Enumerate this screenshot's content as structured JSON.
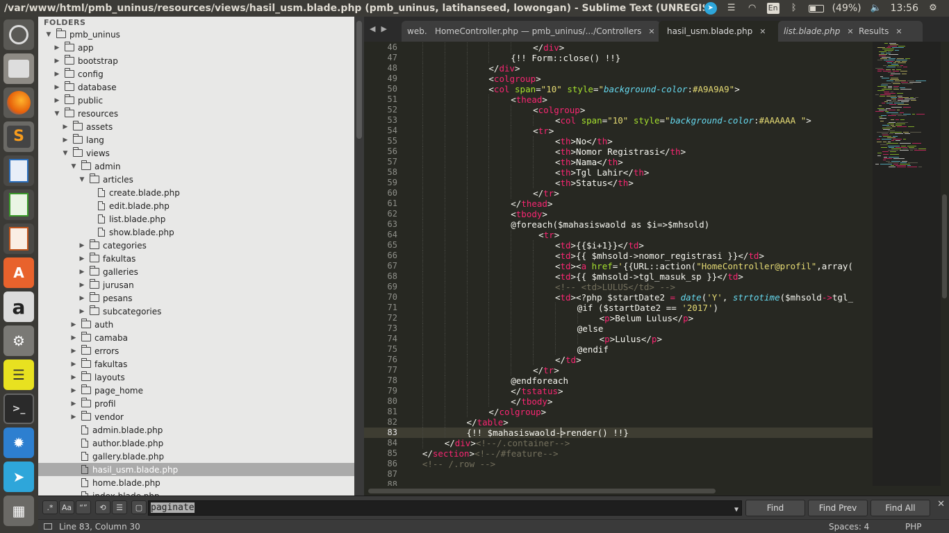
{
  "window": {
    "title": "/var/www/html/pmb_uninus/resources/views/hasil_usm.blade.php (pmb_uninus, latihanseed, lowongan) - Sublime Text (UNREGISTERED)"
  },
  "indicators": {
    "keyboard": "En",
    "battery": "(49%)",
    "clock": "13:56"
  },
  "sidebar": {
    "header": "FOLDERS",
    "items": [
      {
        "label": "pmb_uninus",
        "type": "folder",
        "open": true,
        "depth": 0
      },
      {
        "label": "app",
        "type": "folder",
        "open": false,
        "depth": 1
      },
      {
        "label": "bootstrap",
        "type": "folder",
        "open": false,
        "depth": 1
      },
      {
        "label": "config",
        "type": "folder",
        "open": false,
        "depth": 1
      },
      {
        "label": "database",
        "type": "folder",
        "open": false,
        "depth": 1
      },
      {
        "label": "public",
        "type": "folder",
        "open": false,
        "depth": 1
      },
      {
        "label": "resources",
        "type": "folder",
        "open": true,
        "depth": 1
      },
      {
        "label": "assets",
        "type": "folder",
        "open": false,
        "depth": 2
      },
      {
        "label": "lang",
        "type": "folder",
        "open": false,
        "depth": 2
      },
      {
        "label": "views",
        "type": "folder",
        "open": true,
        "depth": 2
      },
      {
        "label": "admin",
        "type": "folder",
        "open": true,
        "depth": 3
      },
      {
        "label": "articles",
        "type": "folder",
        "open": true,
        "depth": 4
      },
      {
        "label": "create.blade.php",
        "type": "file",
        "depth": 5
      },
      {
        "label": "edit.blade.php",
        "type": "file",
        "depth": 5
      },
      {
        "label": "list.blade.php",
        "type": "file",
        "depth": 5
      },
      {
        "label": "show.blade.php",
        "type": "file",
        "depth": 5
      },
      {
        "label": "categories",
        "type": "folder",
        "open": false,
        "depth": 4
      },
      {
        "label": "fakultas",
        "type": "folder",
        "open": false,
        "depth": 4
      },
      {
        "label": "galleries",
        "type": "folder",
        "open": false,
        "depth": 4
      },
      {
        "label": "jurusan",
        "type": "folder",
        "open": false,
        "depth": 4
      },
      {
        "label": "pesans",
        "type": "folder",
        "open": false,
        "depth": 4
      },
      {
        "label": "subcategories",
        "type": "folder",
        "open": false,
        "depth": 4
      },
      {
        "label": "auth",
        "type": "folder",
        "open": false,
        "depth": 3
      },
      {
        "label": "camaba",
        "type": "folder",
        "open": false,
        "depth": 3
      },
      {
        "label": "errors",
        "type": "folder",
        "open": false,
        "depth": 3
      },
      {
        "label": "fakultas",
        "type": "folder",
        "open": false,
        "depth": 3
      },
      {
        "label": "layouts",
        "type": "folder",
        "open": false,
        "depth": 3
      },
      {
        "label": "page_home",
        "type": "folder",
        "open": false,
        "depth": 3
      },
      {
        "label": "profil",
        "type": "folder",
        "open": false,
        "depth": 3
      },
      {
        "label": "vendor",
        "type": "folder",
        "open": false,
        "depth": 3
      },
      {
        "label": "admin.blade.php",
        "type": "file",
        "depth": 3
      },
      {
        "label": "author.blade.php",
        "type": "file",
        "depth": 3
      },
      {
        "label": "gallery.blade.php",
        "type": "file",
        "depth": 3
      },
      {
        "label": "hasil_usm.blade.php",
        "type": "file",
        "depth": 3,
        "selected": true
      },
      {
        "label": "home.blade.php",
        "type": "file",
        "depth": 3
      },
      {
        "label": "index.blade.php",
        "type": "file",
        "depth": 3
      }
    ]
  },
  "tabs": [
    {
      "label": "web.",
      "close": ""
    },
    {
      "label": "HomeController.php — pmb_uninus/.../Controllers",
      "close": "✕"
    },
    {
      "label": "hasil_usm.blade.php",
      "close": "✕",
      "active": true
    },
    {
      "label": "list.blade.php",
      "close": "✕",
      "italic": true
    },
    {
      "label": "Results",
      "close": "✕"
    }
  ],
  "editor": {
    "current_line": 83,
    "lines": [
      {
        "n": "46",
        "indent": 6,
        "tokens": [
          [
            "p",
            "</"
          ],
          [
            "t",
            "div"
          ],
          [
            "p",
            ">"
          ]
        ]
      },
      {
        "n": "47",
        "indent": 5,
        "tokens": [
          [
            "k",
            "{!! Form::close() !!}"
          ]
        ]
      },
      {
        "n": "48",
        "indent": 4,
        "tokens": [
          [
            "p",
            "</"
          ],
          [
            "t",
            "div"
          ],
          [
            "p",
            ">"
          ]
        ]
      },
      {
        "n": "49",
        "indent": 4,
        "tokens": [
          [
            "p",
            "<"
          ],
          [
            "t",
            "colgroup"
          ],
          [
            "p",
            ">"
          ]
        ]
      },
      {
        "n": "50",
        "indent": 4,
        "tokens": [
          [
            "p",
            "<"
          ],
          [
            "t",
            "col"
          ],
          [
            "p",
            " "
          ],
          [
            "a",
            "span"
          ],
          [
            "p",
            "="
          ],
          [
            "s",
            "\"10\""
          ],
          [
            "p",
            " "
          ],
          [
            "a",
            "style"
          ],
          [
            "p",
            "="
          ],
          [
            "s",
            "\""
          ],
          [
            "v",
            "background-color"
          ],
          [
            "p",
            ":"
          ],
          [
            "s",
            "#A9A9A9\""
          ],
          [
            "p",
            ">"
          ]
        ]
      },
      {
        "n": "51",
        "indent": 5,
        "tokens": [
          [
            "p",
            "<"
          ],
          [
            "t",
            "thead"
          ],
          [
            "p",
            ">"
          ]
        ]
      },
      {
        "n": "52",
        "indent": 6,
        "tokens": [
          [
            "p",
            "<"
          ],
          [
            "t",
            "colgroup"
          ],
          [
            "p",
            ">"
          ]
        ]
      },
      {
        "n": "53",
        "indent": 7,
        "tokens": [
          [
            "p",
            "<"
          ],
          [
            "t",
            "col"
          ],
          [
            "p",
            " "
          ],
          [
            "a",
            "span"
          ],
          [
            "p",
            "="
          ],
          [
            "s",
            "\"10\""
          ],
          [
            "p",
            " "
          ],
          [
            "a",
            "style"
          ],
          [
            "p",
            "="
          ],
          [
            "s",
            "\""
          ],
          [
            "v",
            "background-color"
          ],
          [
            "p",
            ":"
          ],
          [
            "s",
            "#AAAAAA \""
          ],
          [
            "p",
            ">"
          ]
        ]
      },
      {
        "n": "54",
        "indent": 6,
        "tokens": [
          [
            "p",
            "<"
          ],
          [
            "t",
            "tr"
          ],
          [
            "p",
            ">"
          ]
        ]
      },
      {
        "n": "55",
        "indent": 7,
        "tokens": [
          [
            "p",
            "<"
          ],
          [
            "t",
            "th"
          ],
          [
            "p",
            ">No</"
          ],
          [
            "t",
            "th"
          ],
          [
            "p",
            ">"
          ]
        ]
      },
      {
        "n": "56",
        "indent": 7,
        "tokens": [
          [
            "p",
            "<"
          ],
          [
            "t",
            "th"
          ],
          [
            "p",
            ">Nomor Registrasi</"
          ],
          [
            "t",
            "th"
          ],
          [
            "p",
            ">"
          ]
        ]
      },
      {
        "n": "57",
        "indent": 7,
        "tokens": [
          [
            "p",
            "<"
          ],
          [
            "t",
            "th"
          ],
          [
            "p",
            ">Nama</"
          ],
          [
            "t",
            "th"
          ],
          [
            "p",
            ">"
          ]
        ]
      },
      {
        "n": "58",
        "indent": 7,
        "tokens": [
          [
            "p",
            "<"
          ],
          [
            "t",
            "th"
          ],
          [
            "p",
            ">Tgl Lahir</"
          ],
          [
            "t",
            "th"
          ],
          [
            "p",
            ">"
          ]
        ]
      },
      {
        "n": "59",
        "indent": 7,
        "tokens": [
          [
            "p",
            "<"
          ],
          [
            "t",
            "th"
          ],
          [
            "p",
            ">Status</"
          ],
          [
            "t",
            "th"
          ],
          [
            "p",
            ">"
          ]
        ]
      },
      {
        "n": "60",
        "indent": 6,
        "tokens": [
          [
            "p",
            "</"
          ],
          [
            "t",
            "tr"
          ],
          [
            "p",
            ">"
          ]
        ]
      },
      {
        "n": "61",
        "indent": 5,
        "tokens": [
          [
            "p",
            "</"
          ],
          [
            "t",
            "thead"
          ],
          [
            "p",
            ">"
          ]
        ]
      },
      {
        "n": "62",
        "indent": 5,
        "tokens": [
          [
            "p",
            "<"
          ],
          [
            "t",
            "tbody"
          ],
          [
            "p",
            ">"
          ]
        ]
      },
      {
        "n": "63",
        "indent": 5,
        "tokens": [
          [
            "k",
            "@foreach($mahasiswaold as $i=>$mhsold)"
          ]
        ]
      },
      {
        "n": "64",
        "indent": 6,
        "pad": 1,
        "tokens": [
          [
            "p",
            "<"
          ],
          [
            "t",
            "tr"
          ],
          [
            "p",
            ">"
          ]
        ]
      },
      {
        "n": "65",
        "indent": 7,
        "tokens": [
          [
            "p",
            "<"
          ],
          [
            "t",
            "td"
          ],
          [
            "p",
            ">{{$i+1}}</"
          ],
          [
            "t",
            "td"
          ],
          [
            "p",
            ">"
          ]
        ]
      },
      {
        "n": "66",
        "indent": 7,
        "tokens": [
          [
            "p",
            "<"
          ],
          [
            "t",
            "td"
          ],
          [
            "p",
            ">{{ $mhsold->nomor_registrasi }}</"
          ],
          [
            "t",
            "td"
          ],
          [
            "p",
            ">"
          ]
        ]
      },
      {
        "n": "67",
        "indent": 7,
        "tokens": [
          [
            "p",
            "<"
          ],
          [
            "t",
            "td"
          ],
          [
            "p",
            "><"
          ],
          [
            "t",
            "a"
          ],
          [
            "p",
            " "
          ],
          [
            "a",
            "href"
          ],
          [
            "p",
            "="
          ],
          [
            "s",
            "'"
          ],
          [
            "p",
            "{{URL::action("
          ],
          [
            "s",
            "\"HomeController@profil\""
          ],
          [
            "p",
            ",array("
          ]
        ]
      },
      {
        "n": "68",
        "indent": 7,
        "tokens": [
          [
            "p",
            "<"
          ],
          [
            "t",
            "td"
          ],
          [
            "p",
            ">{{ $mhsold->tgl_masuk_sp }}</"
          ],
          [
            "t",
            "td"
          ],
          [
            "p",
            ">"
          ]
        ]
      },
      {
        "n": "69",
        "indent": 7,
        "tokens": [
          [
            "c",
            "<!-- <td>LULUS</td> -->"
          ]
        ]
      },
      {
        "n": "70",
        "indent": 7,
        "tokens": [
          [
            "p",
            "<"
          ],
          [
            "t",
            "td"
          ],
          [
            "p",
            "><?php $startDate2 "
          ],
          [
            "t",
            "="
          ],
          [
            "p",
            " "
          ],
          [
            "v",
            "date"
          ],
          [
            "p",
            "("
          ],
          [
            "s",
            "'Y'"
          ],
          [
            "p",
            ", "
          ],
          [
            "v",
            "strtotime"
          ],
          [
            "p",
            "($mhsold"
          ],
          [
            "t",
            "->"
          ],
          [
            "p",
            "tgl_"
          ]
        ]
      },
      {
        "n": "71",
        "indent": 8,
        "tokens": [
          [
            "k",
            "@if ($startDate2 == "
          ],
          [
            "s",
            "'2017'"
          ],
          [
            "k",
            ")"
          ]
        ]
      },
      {
        "n": "72",
        "indent": 9,
        "tokens": [
          [
            "p",
            "<"
          ],
          [
            "t",
            "p"
          ],
          [
            "p",
            ">Belum Lulus</"
          ],
          [
            "t",
            "p"
          ],
          [
            "p",
            ">"
          ]
        ]
      },
      {
        "n": "73",
        "indent": 8,
        "tokens": [
          [
            "k",
            "@else"
          ]
        ]
      },
      {
        "n": "74",
        "indent": 9,
        "tokens": [
          [
            "p",
            "<"
          ],
          [
            "t",
            "p"
          ],
          [
            "p",
            ">Lulus</"
          ],
          [
            "t",
            "p"
          ],
          [
            "p",
            ">"
          ]
        ]
      },
      {
        "n": "75",
        "indent": 8,
        "tokens": [
          [
            "k",
            "@endif"
          ]
        ]
      },
      {
        "n": "76",
        "indent": 7,
        "tokens": [
          [
            "p",
            "</"
          ],
          [
            "t",
            "td"
          ],
          [
            "p",
            ">"
          ]
        ]
      },
      {
        "n": "77",
        "indent": 6,
        "tokens": [
          [
            "p",
            "</"
          ],
          [
            "t",
            "tr"
          ],
          [
            "p",
            ">"
          ]
        ]
      },
      {
        "n": "78",
        "indent": 5,
        "tokens": [
          [
            "k",
            "@endforeach"
          ]
        ]
      },
      {
        "n": "79",
        "indent": 5,
        "tokens": [
          [
            "p",
            "</"
          ],
          [
            "t",
            "tstatus"
          ],
          [
            "p",
            ">"
          ]
        ]
      },
      {
        "n": "80",
        "indent": 5,
        "tokens": [
          [
            "p",
            "</"
          ],
          [
            "t",
            "tbody"
          ],
          [
            "p",
            ">"
          ]
        ]
      },
      {
        "n": "81",
        "indent": 4,
        "tokens": [
          [
            "p",
            "</"
          ],
          [
            "t",
            "colgroup"
          ],
          [
            "p",
            ">"
          ]
        ]
      },
      {
        "n": "82",
        "indent": 3,
        "tokens": [
          [
            "p",
            "</"
          ],
          [
            "t",
            "table"
          ],
          [
            "p",
            ">"
          ]
        ]
      },
      {
        "n": "83",
        "indent": 3,
        "tokens": [
          [
            "k",
            "{!! $mahasiswaold->render() !!}"
          ]
        ]
      },
      {
        "n": "84",
        "indent": 2,
        "tokens": [
          [
            "p",
            "</"
          ],
          [
            "t",
            "div"
          ],
          [
            "p",
            ">"
          ],
          [
            "c",
            "<!--/.container-->"
          ]
        ]
      },
      {
        "n": "85",
        "indent": 1,
        "tokens": [
          [
            "p",
            "</"
          ],
          [
            "t",
            "section"
          ],
          [
            "p",
            ">"
          ],
          [
            "c",
            "<!--/#feature-->"
          ]
        ]
      },
      {
        "n": "86",
        "indent": 1,
        "tokens": [
          [
            "c",
            "<!-- /.row -->"
          ]
        ]
      },
      {
        "n": "87",
        "indent": 0,
        "tokens": []
      },
      {
        "n": "88",
        "indent": 0,
        "tokens": []
      }
    ]
  },
  "findbar": {
    "regex": ".*",
    "case": "Aa",
    "word": "“”",
    "query": "paginate",
    "find_label": "Find",
    "find_prev_label": "Find Prev",
    "find_all_label": "Find All",
    "close": "✕"
  },
  "statusbar": {
    "position": "Line 83, Column 30",
    "spaces": "Spaces: 4",
    "syntax": "PHP"
  },
  "colors": {
    "editor_bg": "#272822",
    "tag": "#f92672",
    "attr": "#a6e22e",
    "string": "#e6db74",
    "comment": "#75715e",
    "keyword_italic": "#66d9ef"
  }
}
